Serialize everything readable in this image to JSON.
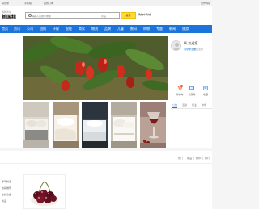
{
  "colors": {
    "nav_blue": "#1b74d9",
    "search_yellow": "#ffd83a",
    "accent_orange": "#f25b2a"
  },
  "topbar": {
    "location": "请登录",
    "links": [
      "手机版",
      "我的订单"
    ],
    "right": "合作网站"
  },
  "header": {
    "logo_small": "购物商城",
    "logo_main": "新国精",
    "search_placeholder": "请输入关键字搜索",
    "search_category": "商品",
    "search_button": "搜索",
    "cart_label": "购物车商城"
  },
  "nav": {
    "items": [
      "首页",
      "资讯",
      "公司",
      "团购",
      "环保",
      "智能",
      "商家",
      "物流",
      "品牌",
      "儿童",
      "数码",
      "购物",
      "专题",
      "新闻",
      "旅游"
    ]
  },
  "banner": {
    "icon": "peppers-photo",
    "slides": 3,
    "active_slide": 1
  },
  "thumbnails": [
    {
      "icon": "bedroom-photo"
    },
    {
      "icon": "bedding-photo"
    },
    {
      "icon": "bed-set-photo"
    },
    {
      "icon": "pillow-photo"
    },
    {
      "icon": "wine-glass-photo"
    }
  ],
  "user_panel": {
    "greeting": "Hi,欢迎您",
    "login": "请登录注册",
    "register": "免费注册",
    "quick_links": [
      {
        "icon": "cart-icon",
        "label": "购物车"
      },
      {
        "icon": "coupon-icon",
        "label": "优惠券"
      },
      {
        "icon": "favorite-icon",
        "label": "收藏"
      }
    ],
    "tabs": [
      "公告",
      "活动",
      "行业",
      "市场"
    ]
  },
  "section2": {
    "filters": [
      "热门",
      "新品",
      "推荐",
      "排行"
    ],
    "side_items": [
      "季节精选",
      "热销推荐",
      "生鲜食品",
      "新品"
    ],
    "card": {
      "icon": "cherries-photo"
    }
  }
}
